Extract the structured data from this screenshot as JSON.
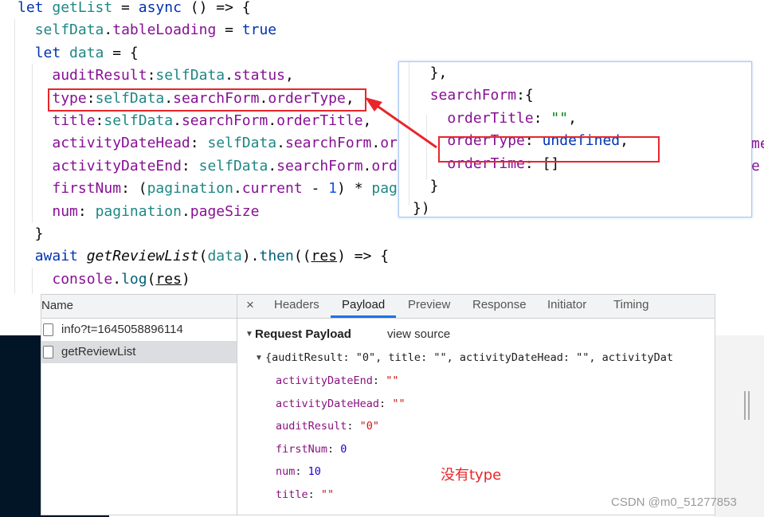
{
  "editor": {
    "lines": [
      [
        {
          "t": "let ",
          "c": "kw"
        },
        {
          "t": "getList",
          "c": "vr"
        },
        {
          "t": " = ",
          "c": "pl"
        },
        {
          "t": "async",
          "c": "kw"
        },
        {
          "t": " () => {",
          "c": "pl"
        }
      ],
      [
        {
          "t": "  "
        },
        {
          "t": "selfData",
          "c": "vr"
        },
        {
          "t": ".",
          "c": "pl"
        },
        {
          "t": "tableLoading",
          "c": "pr"
        },
        {
          "t": " = ",
          "c": "pl"
        },
        {
          "t": "true",
          "c": "kw"
        }
      ],
      [
        {
          "t": "  "
        },
        {
          "t": "let ",
          "c": "kw"
        },
        {
          "t": "data",
          "c": "vr"
        },
        {
          "t": " = {",
          "c": "pl"
        }
      ],
      [
        {
          "t": "    "
        },
        {
          "t": "auditResult",
          "c": "pr"
        },
        {
          "t": ":",
          "c": "pl"
        },
        {
          "t": "selfData",
          "c": "vr"
        },
        {
          "t": ".",
          "c": "pl"
        },
        {
          "t": "status",
          "c": "pr"
        },
        {
          "t": ",",
          "c": "pl"
        }
      ],
      [
        {
          "t": "    "
        },
        {
          "t": "type",
          "c": "pr"
        },
        {
          "t": ":",
          "c": "pl"
        },
        {
          "t": "selfData",
          "c": "vr"
        },
        {
          "t": ".",
          "c": "pl"
        },
        {
          "t": "searchForm",
          "c": "pr"
        },
        {
          "t": ".",
          "c": "pl"
        },
        {
          "t": "orderType",
          "c": "pr"
        },
        {
          "t": ",",
          "c": "pl"
        }
      ],
      [
        {
          "t": "    "
        },
        {
          "t": "title",
          "c": "pr"
        },
        {
          "t": ":",
          "c": "pl"
        },
        {
          "t": "selfData",
          "c": "vr"
        },
        {
          "t": ".",
          "c": "pl"
        },
        {
          "t": "searchForm",
          "c": "pr"
        },
        {
          "t": ".",
          "c": "pl"
        },
        {
          "t": "orderTitle",
          "c": "pr"
        },
        {
          "t": ",",
          "c": "pl"
        }
      ],
      [
        {
          "t": "    "
        },
        {
          "t": "activityDateHead",
          "c": "pr"
        },
        {
          "t": ": ",
          "c": "pl"
        },
        {
          "t": "selfData",
          "c": "vr"
        },
        {
          "t": ".",
          "c": "pl"
        },
        {
          "t": "searchForm",
          "c": "pr"
        },
        {
          "t": ".",
          "c": "pl"
        },
        {
          "t": "orderTime",
          "c": "pr"
        }
      ],
      [
        {
          "t": "    "
        },
        {
          "t": "activityDateEnd",
          "c": "pr"
        },
        {
          "t": ": ",
          "c": "pl"
        },
        {
          "t": "selfData",
          "c": "vr"
        },
        {
          "t": ".",
          "c": "pl"
        },
        {
          "t": "searchForm",
          "c": "pr"
        },
        {
          "t": ".",
          "c": "pl"
        },
        {
          "t": "orderTime",
          "c": "pr"
        }
      ],
      [
        {
          "t": "    "
        },
        {
          "t": "firstNum",
          "c": "pr"
        },
        {
          "t": ": (",
          "c": "pl"
        },
        {
          "t": "pagination",
          "c": "vr"
        },
        {
          "t": ".",
          "c": "pl"
        },
        {
          "t": "current",
          "c": "pr"
        },
        {
          "t": " - ",
          "c": "pl"
        },
        {
          "t": "1",
          "c": "nm"
        },
        {
          "t": ") * ",
          "c": "pl"
        },
        {
          "t": "pagination",
          "c": "vr"
        }
      ],
      [
        {
          "t": "    "
        },
        {
          "t": "num",
          "c": "pr"
        },
        {
          "t": ": ",
          "c": "pl"
        },
        {
          "t": "pagination",
          "c": "vr"
        },
        {
          "t": ".",
          "c": "pl"
        },
        {
          "t": "pageSize",
          "c": "pr"
        }
      ],
      [
        {
          "t": "  }",
          "c": "pl"
        }
      ],
      [
        {
          "t": "  "
        },
        {
          "t": "await ",
          "c": "kw"
        },
        {
          "t": "getReviewList",
          "c": "fn"
        },
        {
          "t": "(",
          "c": "pl"
        },
        {
          "t": "data",
          "c": "vr"
        },
        {
          "t": ").",
          "c": "pl"
        },
        {
          "t": "then",
          "c": "mt"
        },
        {
          "t": "((",
          "c": "pl"
        },
        {
          "t": "res",
          "c": "pl ul"
        },
        {
          "t": ") => {",
          "c": "pl"
        }
      ],
      [
        {
          "t": "    "
        },
        {
          "t": "console",
          "c": "pr"
        },
        {
          "t": ".",
          "c": "pl"
        },
        {
          "t": "log",
          "c": "mt"
        },
        {
          "t": "(",
          "c": "pl"
        },
        {
          "t": "res",
          "c": "pl ul"
        },
        {
          "t": ")",
          "c": "pl"
        }
      ]
    ]
  },
  "popup": {
    "lines": [
      [
        {
          "t": "  },",
          "c": "pl"
        }
      ],
      [
        {
          "t": "  "
        },
        {
          "t": "searchForm",
          "c": "pr"
        },
        {
          "t": ":{",
          "c": "pl"
        }
      ],
      [
        {
          "t": "    "
        },
        {
          "t": "orderTitle",
          "c": "pr"
        },
        {
          "t": ": ",
          "c": "pl"
        },
        {
          "t": "\"\"",
          "c": "st"
        },
        {
          "t": ",",
          "c": "pl"
        }
      ],
      [
        {
          "t": "    "
        },
        {
          "t": "orderType",
          "c": "pr"
        },
        {
          "t": ": ",
          "c": "pl"
        },
        {
          "t": "undefined",
          "c": "kw"
        },
        {
          "t": ",",
          "c": "pl"
        }
      ],
      [
        {
          "t": "    "
        },
        {
          "t": "orderTime",
          "c": "pr"
        },
        {
          "t": ": []",
          "c": "pl"
        }
      ],
      [
        {
          "t": "  }",
          "c": "pl"
        }
      ],
      [
        {
          "t": "})",
          "c": "pl"
        }
      ]
    ]
  },
  "devtools": {
    "name_header": "Name",
    "requests": [
      {
        "name": "info?t=1645058896114",
        "selected": false
      },
      {
        "name": "getReviewList",
        "selected": true
      }
    ],
    "close_icon": "×",
    "tabs": [
      {
        "label": "Headers",
        "active": false
      },
      {
        "label": "Payload",
        "active": true
      },
      {
        "label": "Preview",
        "active": false
      },
      {
        "label": "Response",
        "active": false
      },
      {
        "label": "Initiator",
        "active": false
      },
      {
        "label": "Timing",
        "active": false
      }
    ],
    "payload": {
      "section_title": "Request Payload",
      "view_source": "view source",
      "summary": "{auditResult: \"0\", title: \"\", activityDateHead: \"\", activityDat",
      "props": [
        {
          "key": "activityDateEnd",
          "value": "\"\"",
          "type": "string"
        },
        {
          "key": "activityDateHead",
          "value": "\"\"",
          "type": "string"
        },
        {
          "key": "auditResult",
          "value": "\"0\"",
          "type": "string"
        },
        {
          "key": "firstNum",
          "value": "0",
          "type": "number"
        },
        {
          "key": "num",
          "value": "10",
          "type": "number"
        },
        {
          "key": "title",
          "value": "\"\"",
          "type": "string"
        }
      ]
    }
  },
  "annotation": {
    "note": "没有type",
    "color": "#e8262b"
  },
  "watermark": "CSDN @m0_51277853"
}
